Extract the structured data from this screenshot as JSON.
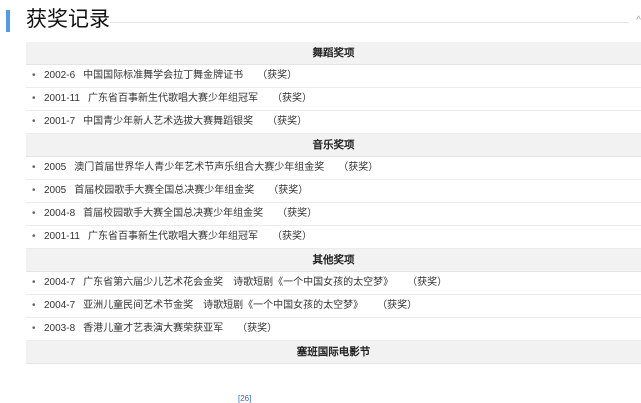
{
  "section": {
    "title": "获奖记录",
    "edit_mark": "^"
  },
  "categories": [
    {
      "name": "舞蹈奖项",
      "items": [
        {
          "date": "2002-6",
          "award": "中国国际标准舞学会拉丁舞金牌证书",
          "result": "（获奖）"
        },
        {
          "date": "2001-11",
          "award": "广东省百事新生代歌唱大赛少年组冠军",
          "result": "（获奖）"
        },
        {
          "date": "2001-7",
          "award": "中国青少年新人艺术选拔大赛舞蹈银奖",
          "result": "（获奖）"
        }
      ]
    },
    {
      "name": "音乐奖项",
      "items": [
        {
          "date": "2005",
          "award": "澳门首届世界华人青少年艺术节声乐组合大赛少年组金奖",
          "result": "（获奖）"
        },
        {
          "date": "2005",
          "award": "首届校园歌手大赛全国总决赛少年组金奖",
          "result": "（获奖）"
        },
        {
          "date": "2004-8",
          "award": "首届校园歌手大赛全国总决赛少年组金奖",
          "result": "（获奖）"
        },
        {
          "date": "2001-11",
          "award": "广东省百事新生代歌唱大赛少年组冠军",
          "result": "（获奖）"
        }
      ]
    },
    {
      "name": "其他奖项",
      "items": [
        {
          "date": "2004-7",
          "award": "广东省第六届少儿艺术花会金奖　诗歌短剧《一个中国女孩的太空梦》",
          "result": "（获奖）"
        },
        {
          "date": "2004-7",
          "award": "亚洲儿童民间艺术节金奖　诗歌短剧《一个中国女孩的太空梦》",
          "result": "（获奖）"
        },
        {
          "date": "2003-8",
          "award": "香港儿童才艺表演大赛荣获亚军",
          "result": "（获奖）"
        }
      ]
    },
    {
      "name": "塞班国际电影节",
      "items": []
    }
  ],
  "citation": "[26]"
}
